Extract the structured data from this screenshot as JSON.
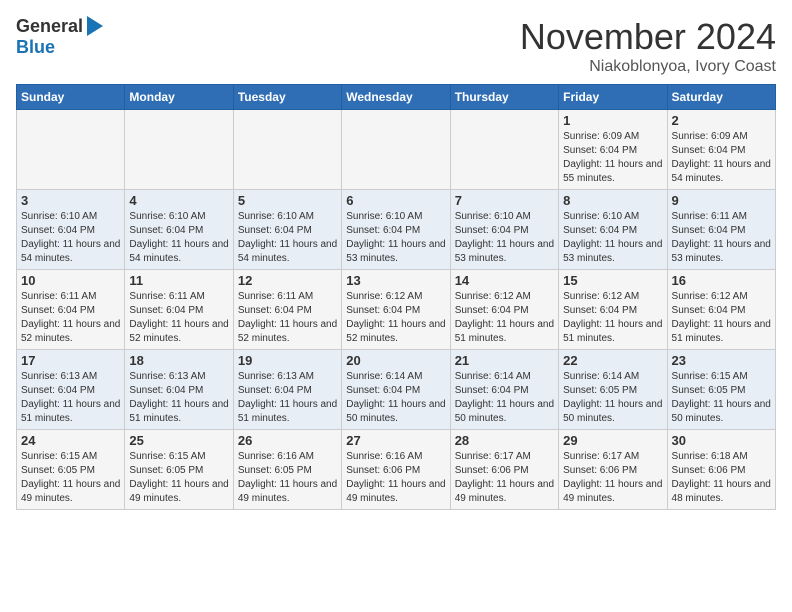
{
  "header": {
    "logo_general": "General",
    "logo_blue": "Blue",
    "month_title": "November 2024",
    "location": "Niakoblonyoa, Ivory Coast"
  },
  "days_of_week": [
    "Sunday",
    "Monday",
    "Tuesday",
    "Wednesday",
    "Thursday",
    "Friday",
    "Saturday"
  ],
  "weeks": [
    [
      {
        "day": "",
        "info": ""
      },
      {
        "day": "",
        "info": ""
      },
      {
        "day": "",
        "info": ""
      },
      {
        "day": "",
        "info": ""
      },
      {
        "day": "",
        "info": ""
      },
      {
        "day": "1",
        "info": "Sunrise: 6:09 AM\nSunset: 6:04 PM\nDaylight: 11 hours and 55 minutes."
      },
      {
        "day": "2",
        "info": "Sunrise: 6:09 AM\nSunset: 6:04 PM\nDaylight: 11 hours and 54 minutes."
      }
    ],
    [
      {
        "day": "3",
        "info": "Sunrise: 6:10 AM\nSunset: 6:04 PM\nDaylight: 11 hours and 54 minutes."
      },
      {
        "day": "4",
        "info": "Sunrise: 6:10 AM\nSunset: 6:04 PM\nDaylight: 11 hours and 54 minutes."
      },
      {
        "day": "5",
        "info": "Sunrise: 6:10 AM\nSunset: 6:04 PM\nDaylight: 11 hours and 54 minutes."
      },
      {
        "day": "6",
        "info": "Sunrise: 6:10 AM\nSunset: 6:04 PM\nDaylight: 11 hours and 53 minutes."
      },
      {
        "day": "7",
        "info": "Sunrise: 6:10 AM\nSunset: 6:04 PM\nDaylight: 11 hours and 53 minutes."
      },
      {
        "day": "8",
        "info": "Sunrise: 6:10 AM\nSunset: 6:04 PM\nDaylight: 11 hours and 53 minutes."
      },
      {
        "day": "9",
        "info": "Sunrise: 6:11 AM\nSunset: 6:04 PM\nDaylight: 11 hours and 53 minutes."
      }
    ],
    [
      {
        "day": "10",
        "info": "Sunrise: 6:11 AM\nSunset: 6:04 PM\nDaylight: 11 hours and 52 minutes."
      },
      {
        "day": "11",
        "info": "Sunrise: 6:11 AM\nSunset: 6:04 PM\nDaylight: 11 hours and 52 minutes."
      },
      {
        "day": "12",
        "info": "Sunrise: 6:11 AM\nSunset: 6:04 PM\nDaylight: 11 hours and 52 minutes."
      },
      {
        "day": "13",
        "info": "Sunrise: 6:12 AM\nSunset: 6:04 PM\nDaylight: 11 hours and 52 minutes."
      },
      {
        "day": "14",
        "info": "Sunrise: 6:12 AM\nSunset: 6:04 PM\nDaylight: 11 hours and 51 minutes."
      },
      {
        "day": "15",
        "info": "Sunrise: 6:12 AM\nSunset: 6:04 PM\nDaylight: 11 hours and 51 minutes."
      },
      {
        "day": "16",
        "info": "Sunrise: 6:12 AM\nSunset: 6:04 PM\nDaylight: 11 hours and 51 minutes."
      }
    ],
    [
      {
        "day": "17",
        "info": "Sunrise: 6:13 AM\nSunset: 6:04 PM\nDaylight: 11 hours and 51 minutes."
      },
      {
        "day": "18",
        "info": "Sunrise: 6:13 AM\nSunset: 6:04 PM\nDaylight: 11 hours and 51 minutes."
      },
      {
        "day": "19",
        "info": "Sunrise: 6:13 AM\nSunset: 6:04 PM\nDaylight: 11 hours and 51 minutes."
      },
      {
        "day": "20",
        "info": "Sunrise: 6:14 AM\nSunset: 6:04 PM\nDaylight: 11 hours and 50 minutes."
      },
      {
        "day": "21",
        "info": "Sunrise: 6:14 AM\nSunset: 6:04 PM\nDaylight: 11 hours and 50 minutes."
      },
      {
        "day": "22",
        "info": "Sunrise: 6:14 AM\nSunset: 6:05 PM\nDaylight: 11 hours and 50 minutes."
      },
      {
        "day": "23",
        "info": "Sunrise: 6:15 AM\nSunset: 6:05 PM\nDaylight: 11 hours and 50 minutes."
      }
    ],
    [
      {
        "day": "24",
        "info": "Sunrise: 6:15 AM\nSunset: 6:05 PM\nDaylight: 11 hours and 49 minutes."
      },
      {
        "day": "25",
        "info": "Sunrise: 6:15 AM\nSunset: 6:05 PM\nDaylight: 11 hours and 49 minutes."
      },
      {
        "day": "26",
        "info": "Sunrise: 6:16 AM\nSunset: 6:05 PM\nDaylight: 11 hours and 49 minutes."
      },
      {
        "day": "27",
        "info": "Sunrise: 6:16 AM\nSunset: 6:06 PM\nDaylight: 11 hours and 49 minutes."
      },
      {
        "day": "28",
        "info": "Sunrise: 6:17 AM\nSunset: 6:06 PM\nDaylight: 11 hours and 49 minutes."
      },
      {
        "day": "29",
        "info": "Sunrise: 6:17 AM\nSunset: 6:06 PM\nDaylight: 11 hours and 49 minutes."
      },
      {
        "day": "30",
        "info": "Sunrise: 6:18 AM\nSunset: 6:06 PM\nDaylight: 11 hours and 48 minutes."
      }
    ]
  ]
}
